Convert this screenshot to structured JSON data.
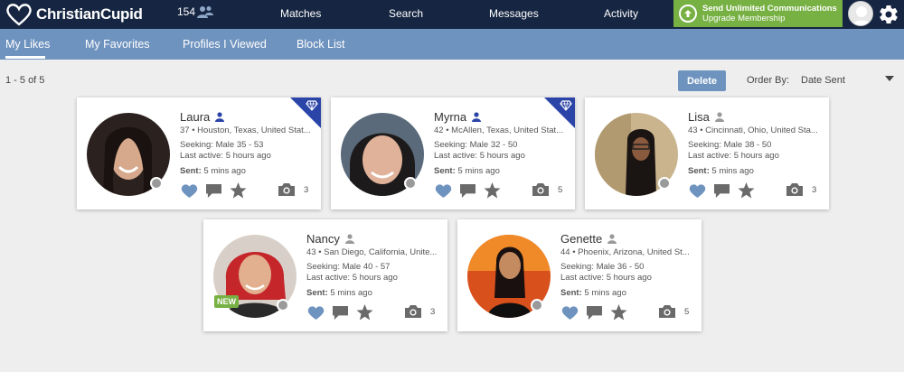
{
  "app": {
    "logo_text": "ChristianCupid"
  },
  "header": {
    "notification_count": "154",
    "nav": [
      "Matches",
      "Search",
      "Messages",
      "Activity"
    ],
    "upgrade": {
      "line1": "Send Unlimited Communications",
      "line2": "Upgrade Membership"
    }
  },
  "subnav": {
    "tabs": [
      "My Likes",
      "My Favorites",
      "Profiles I Viewed",
      "Block List"
    ],
    "active": "My Likes"
  },
  "toolbar": {
    "count_text": "1 - 5 of 5",
    "delete_label": "Delete",
    "order_label": "Order By:",
    "order_value": "Date Sent"
  },
  "profiles": [
    {
      "name": "Laura",
      "location": "37 • Houston, Texas, United Stat...",
      "seeking": "Seeking: Male 35 - 53",
      "last_active": "Last active: 5 hours ago",
      "sent_label": "Sent:",
      "sent_value": "5 mins ago",
      "photos": "3",
      "premium": true,
      "new": false
    },
    {
      "name": "Myrna",
      "location": "42 • McAllen, Texas, United Stat...",
      "seeking": "Seeking: Male 32 - 50",
      "last_active": "Last active: 5 hours ago",
      "sent_label": "Sent:",
      "sent_value": "5 mins ago",
      "photos": "5",
      "premium": true,
      "new": false
    },
    {
      "name": "Lisa",
      "location": "43 • Cincinnati, Ohio, United Sta...",
      "seeking": "Seeking: Male 38 - 50",
      "last_active": "Last active: 5 hours ago",
      "sent_label": "Sent:",
      "sent_value": "5 mins ago",
      "photos": "3",
      "premium": false,
      "new": false
    },
    {
      "name": "Nancy",
      "location": "43 • San Diego, California, Unite...",
      "seeking": "Seeking: Male 40 - 57",
      "last_active": "Last active: 5 hours ago",
      "sent_label": "Sent:",
      "sent_value": "5 mins ago",
      "photos": "3",
      "premium": false,
      "new": true,
      "new_label": "NEW"
    },
    {
      "name": "Genette",
      "location": "44 • Phoenix, Arizona, United St...",
      "seeking": "Seeking: Male 36 - 50",
      "last_active": "Last active: 5 hours ago",
      "sent_label": "Sent:",
      "sent_value": "5 mins ago",
      "photos": "5",
      "premium": false,
      "new": false
    }
  ],
  "colors": {
    "nav_bg": "#162642",
    "subnav_bg": "#6f93bf",
    "upgrade_green": "#77b043",
    "premium_blue": "#2b44a7",
    "like_blue": "#6f93bf"
  },
  "icons": {
    "logo": "heart-logo-icon",
    "notifications": "people-icon",
    "upgrade": "arrow-up-circle-icon",
    "settings": "gear-icon",
    "like": "heart-icon",
    "message": "chat-bubble-icon",
    "favorite": "star-icon",
    "photos": "camera-icon",
    "premium": "diamond-icon"
  }
}
